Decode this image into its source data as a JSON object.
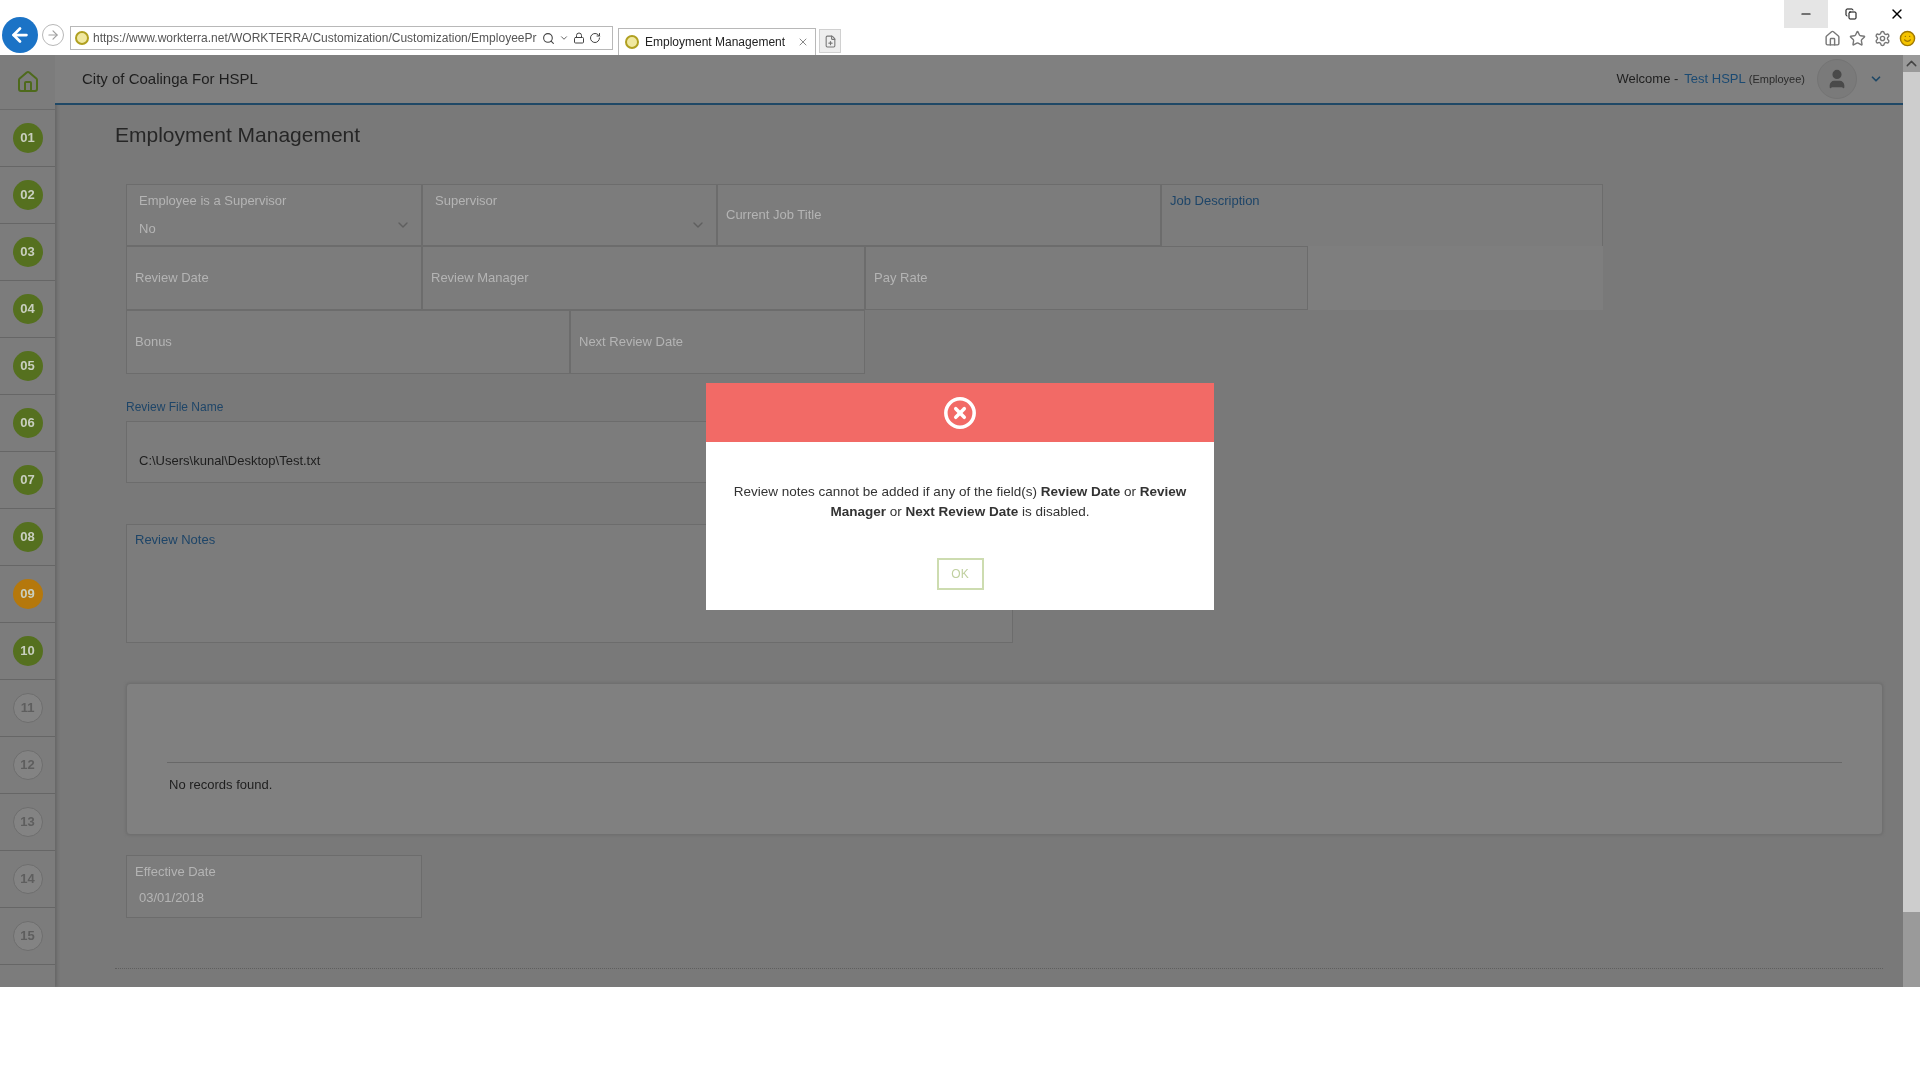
{
  "browser": {
    "address": "https://www.workterra.net/WORKTERRA/Customization/Customization/EmployeePr",
    "tabs": [
      {
        "title": "Employment Management",
        "selected": true
      }
    ]
  },
  "header": {
    "title": "City of Coalinga For HSPL",
    "welcome": "Welcome -",
    "user_name": "Test HSPL",
    "user_role": "(Employee)"
  },
  "sidebar": {
    "items": [
      {
        "label": "01",
        "color": "#55701f",
        "enabled": true
      },
      {
        "label": "02",
        "color": "#55701f",
        "enabled": true
      },
      {
        "label": "03",
        "color": "#55701f",
        "enabled": true
      },
      {
        "label": "04",
        "color": "#55701f",
        "enabled": true
      },
      {
        "label": "05",
        "color": "#55701f",
        "enabled": true
      },
      {
        "label": "06",
        "color": "#55701f",
        "enabled": true
      },
      {
        "label": "07",
        "color": "#55701f",
        "enabled": true
      },
      {
        "label": "08",
        "color": "#55701f",
        "enabled": true
      },
      {
        "label": "09",
        "color": "#b5780c",
        "enabled": true
      },
      {
        "label": "10",
        "color": "#55701f",
        "enabled": true
      },
      {
        "label": "11",
        "color": "#838383",
        "enabled": false
      },
      {
        "label": "12",
        "color": "#838383",
        "enabled": false
      },
      {
        "label": "13",
        "color": "#838383",
        "enabled": false
      },
      {
        "label": "14",
        "color": "#838383",
        "enabled": false
      },
      {
        "label": "15",
        "color": "#838383",
        "enabled": false
      }
    ]
  },
  "page_title": "Employment Management",
  "fields": [
    {
      "label": "Employee is a Supervisor",
      "value": "No",
      "kind": "select"
    },
    {
      "label": "Supervisor",
      "kind": "select"
    },
    {
      "placeholder": "Current Job Title",
      "kind": "text"
    },
    {
      "label": "Job Description",
      "kind": "area"
    },
    {
      "placeholder": "Review Date",
      "kind": "text"
    },
    {
      "placeholder": "Review Manager",
      "kind": "text"
    },
    {
      "placeholder": "Pay Rate",
      "kind": "text"
    },
    {
      "placeholder": "Bonus",
      "kind": "text"
    },
    {
      "placeholder": "Next Review Date",
      "kind": "text"
    }
  ],
  "review_file": {
    "label": "Review File Name",
    "value": "C:\\Users\\kunal\\Desktop\\Test.txt"
  },
  "review_notes": {
    "label": "Review Notes"
  },
  "records": {
    "empty_text": "No records found."
  },
  "effective_date": {
    "label": "Effective Date",
    "value": "03/01/2018"
  },
  "dialog": {
    "message": "Review notes cannot be added if any of the field(s) **Review Date** or **Review Manager** or **Next Review Date** is disabled.",
    "button": "OK"
  }
}
